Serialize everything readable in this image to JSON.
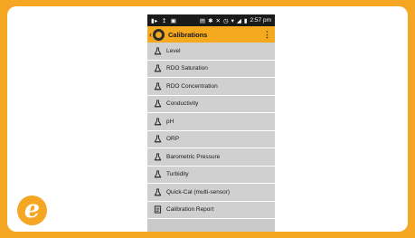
{
  "status_bar": {
    "left_icons": [
      "video-icon",
      "upload-icon",
      "image-icon"
    ],
    "right_icons": [
      "sim-icon",
      "bluetooth-icon",
      "mute-icon",
      "alarm-icon",
      "wifi-icon",
      "signal-icon",
      "battery-icon"
    ],
    "time": "2:57 pm"
  },
  "app_bar": {
    "title": "Calibrations",
    "back_icon": "chevron-left-icon",
    "app_icon": "app-logo-icon",
    "menu_icon": "overflow-menu-icon"
  },
  "calibrations": {
    "items": [
      {
        "label": "Level",
        "icon": "flask-icon"
      },
      {
        "label": "RDO Saturation",
        "icon": "flask-icon"
      },
      {
        "label": "RDO Concentration",
        "icon": "flask-icon"
      },
      {
        "label": "Conductivity",
        "icon": "flask-icon"
      },
      {
        "label": "pH",
        "icon": "flask-icon"
      },
      {
        "label": "ORP",
        "icon": "flask-icon"
      },
      {
        "label": "Barometric Pressure",
        "icon": "flask-icon"
      },
      {
        "label": "Turbidity",
        "icon": "flask-icon"
      },
      {
        "label": "Quick-Cal (multi-sensor)",
        "icon": "flask-icon"
      },
      {
        "label": "Calibration Report",
        "icon": "report-icon"
      }
    ]
  },
  "brand": {
    "logo_letter": "e",
    "accent_color": "#f5a623"
  }
}
